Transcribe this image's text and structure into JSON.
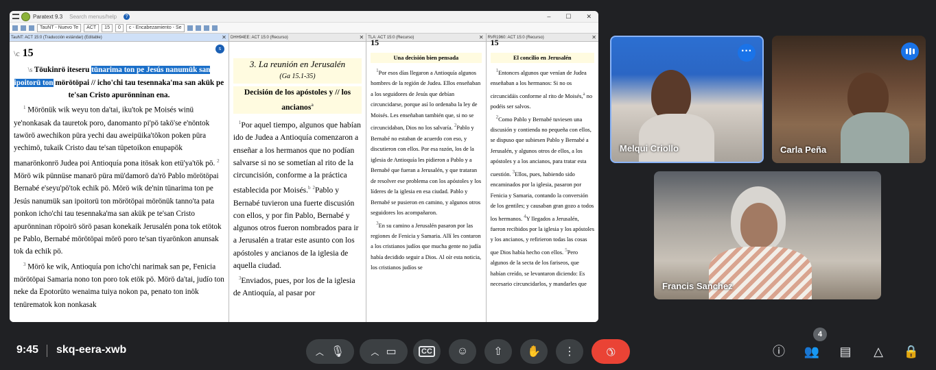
{
  "paratext": {
    "title": "Paratext 9.3",
    "search_placeholder": "Search menus/help",
    "toolbar": {
      "project": "TauNT - Nuevo Te",
      "book": "ACT",
      "chapter": "15",
      "verse": "0",
      "style": "c - Encabezamiento - Se"
    },
    "panes": [
      {
        "header": "TauNT: ACT 15:0 (Traducción estándar) (Editable)"
      },
      {
        "header": "DHH94EE: ACT 15:0 (Recurso)"
      },
      {
        "header": "TLA: ACT 15:0 (Recurso)"
      },
      {
        "header": "RVR1960: ACT 15:0 (Recurso)"
      }
    ],
    "p1": {
      "marker": "\\c",
      "chapter": "15",
      "s_marker": "\\s",
      "head_a": "Töukinrö iteseru ",
      "head_hl": "tünarima ton pe Jesús nanumük san ipoitorü ton",
      "head_b": " mörötöpai // icho'chi tau tesennaka'ma san akük pe te'san Cristo apurönninan ena.",
      "v1": "1",
      "t1": "Mörönük wik weyu ton da'tai, iku'tok pe Moisés winü ye'nonkasak da tauretok poro, danomanto pi'pö takö'se e'nöntok tawörö awechikon püra yechi dau aweipüika'tökon poken püra yechimö, tukaik Cristo dau te'san tüpetoikon enupapök manarönkonrö Judea poi Antioquía pona itösak kon etü'ya'tök pö.",
      "v2": "2",
      "t2": "Mörö wik pünnüse manarö püra mü'damorö da'rö Pablo mörötöpai Bernabé e'seyu'pö'tok echik pö. Mörö wik de'nin tünarima ton pe Jesús nanumük san ipoitorü ton mörötöpai mörönük tanno'ta pata ponkon icho'chi tau tesennaka'ma san akük pe te'san Cristo apurönninan röpoirö sörö pasan konekaik Jerusalén pona tok etötok pe Pablo, Bernabé mörötöpai mörö poro te'san tiyarönkon anunsak tok da echik pö.",
      "v3": "3",
      "t3": "Mörö ke wik, Antioquía pon icho'chi narimak san pe, Fenicia mörötöpai Samaria nono ton poro tok etök pö. Mörö da'tai, judío ton neke da Epotorüto wenaima tuiya nokon pa, penato ton inök tenürematok kon nonkasak"
    },
    "p2": {
      "title": "3. La reunión en Jerusalén",
      "ref": "(Ga 15.1-35)",
      "sect": "Decisión de los apóstoles y // los ancianos",
      "fn_a": "a",
      "v1": "1",
      "t1": "Por aquel tiempo, algunos que habían ido de Judea a Antioquía comenzaron a enseñar a los hermanos que no podían salvarse si no se sometían al rito de la circuncisión, conforme a la práctica establecida por Moisés.",
      "fn_b": "b",
      "v2": "2",
      "t2": "Pablo y Bernabé tuvieron una fuerte discusión con ellos, y por fin Pablo, Bernabé y algunos otros fueron nombrados para ir a Jerusalén a tratar este asunto con los apóstoles y ancianos de la iglesia de aquella ciudad.",
      "v3": "3",
      "t3": "Enviados, pues, por los de la iglesia de Antioquía, al pasar por"
    },
    "p3": {
      "chapter": "15",
      "sect": "Una decisión bien pensada",
      "v1": "1",
      "t1": "Por esos días llegaron a Antioquía algunos hombres de la región de Judea. Ellos enseñaban a los seguidores de Jesús que debían circuncidarse, porque así lo ordenaba la ley de Moisés. Les enseñaban también que, si no se circuncidaban, Dios no los salvaría.",
      "v2": "2",
      "t2": "Pablo y Bernabé no estaban de acuerdo con eso, y discutieron con ellos. Por esa razón, los de la iglesia de Antioquía les pidieron a Pablo y a Bernabé que fueran a Jerusalén, y que trataran de resolver ese problema con los apóstoles y los líderes de la iglesia en esa ciudad. Pablo y Bernabé se pusieron en camino, y algunos otros seguidores los acompañaron.",
      "v3": "3",
      "t3": "En su camino a Jerusalén pasaron por las regiones de Fenicia y Samaria. Allí les contaron a los cristianos judíos que mucha gente no judía había decidido seguir a Dios. Al oír esta noticia, los cristianos judíos se"
    },
    "p4": {
      "chapter": "15",
      "sect": "El concilio en Jerusalén",
      "v1": "1",
      "t1": "Entonces algunos que venían de Judea enseñaban a los hermanos: Si no os circuncidáis conforme al rito de Moisés,",
      "fn": "a",
      "t1b": " no podéis ser salvos.",
      "v2": "2",
      "t2": "Como Pablo y Bernabé tuviesen una discusión y contienda no pequeña con ellos, se dispuso que subiesen Pablo y Bernabé a Jerusalén, y algunos otros de ellos, a los apóstoles y a los ancianos, para tratar esta cuestión.",
      "v3": "3",
      "t3": "Ellos, pues, habiendo sido encaminados por la iglesia, pasaron por Fenicia y Samaria, contando la conversión de los gentiles; y causaban gran gozo a todos los hermanos.",
      "v4": "4",
      "t4": "Y llegados a Jerusalén, fueron recibidos por la iglesia y los apóstoles y los ancianos, y refirieron todas las cosas que Dios había hecho con ellos.",
      "v5": "5",
      "t5": "Pero algunos de la secta de los fariseos, que habían creído, se levantaron diciendo: Es necesario circuncidarlos, y mandarles que"
    }
  },
  "participants": [
    {
      "name": "Melqui Criollo"
    },
    {
      "name": "Carla Peña"
    },
    {
      "name": "Francis Sanchez"
    }
  ],
  "meeting": {
    "time": "9:45",
    "code": "skq-eera-xwb",
    "participant_count": "4"
  },
  "colors": {
    "accent": "#1a73e8",
    "end_call": "#ea4335",
    "bar": "#202124"
  }
}
